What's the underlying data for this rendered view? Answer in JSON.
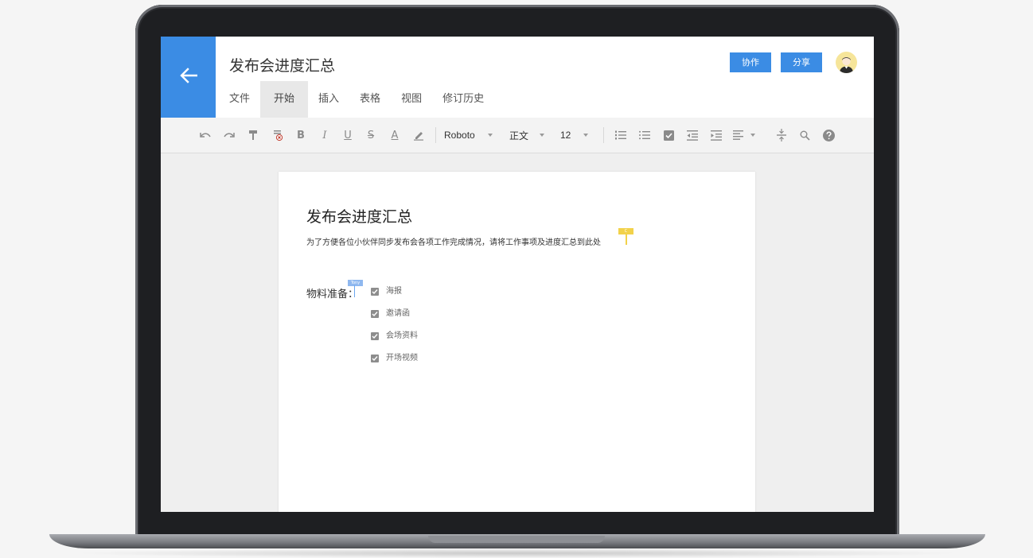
{
  "document": {
    "title": "发布会进度汇总",
    "menu_tabs": [
      {
        "label": "文件"
      },
      {
        "label": "开始",
        "active": true
      },
      {
        "label": "插入"
      },
      {
        "label": "表格"
      },
      {
        "label": "视图"
      },
      {
        "label": "修订历史"
      }
    ]
  },
  "header_buttons": {
    "collaborate_label": "协作",
    "share_label": "分享"
  },
  "toolbar": {
    "font_family": "Roboto",
    "paragraph_style": "正文",
    "font_size": "12",
    "icons": [
      "undo-icon",
      "redo-icon",
      "format-painter-icon",
      "clear-format-icon",
      "bold-icon",
      "italic-icon",
      "underline-icon",
      "strikethrough-icon",
      "font-color-icon",
      "highlight-icon",
      "ordered-list-icon",
      "bullet-list-icon",
      "checkbox-icon",
      "outdent-icon",
      "indent-icon",
      "align-left-icon",
      "divider-icon",
      "search-icon",
      "help-icon"
    ]
  },
  "page": {
    "heading": "发布会进度汇总",
    "description": "为了方便各位小伙伴同步发布会各项工作完成情况，请将工作事项及进度汇总到此处",
    "section_label": "物料准备：",
    "cursor_tags": {
      "yellow": "C",
      "blue": "Tony"
    },
    "checklist": [
      {
        "label": "海报",
        "checked": true
      },
      {
        "label": "邀请函",
        "checked": true
      },
      {
        "label": "会场资料",
        "checked": true
      },
      {
        "label": "开场视频",
        "checked": true
      }
    ]
  },
  "colors": {
    "accent": "#3b8ce4",
    "cursor_yellow": "#f2d24a",
    "cursor_blue": "#8fb8ef"
  }
}
